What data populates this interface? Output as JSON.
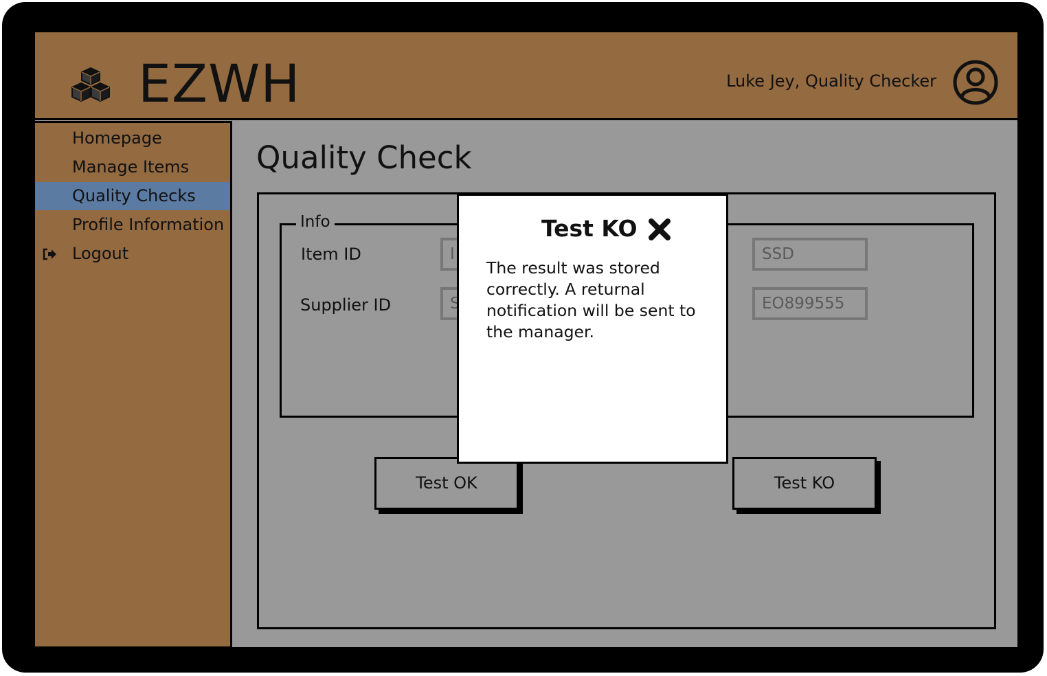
{
  "header": {
    "app_title": "EZWH",
    "user_label": "Luke Jey, Quality Checker"
  },
  "sidebar": {
    "items": [
      {
        "label": "Homepage"
      },
      {
        "label": "Manage Items"
      },
      {
        "label": "Quality Checks",
        "active": true
      },
      {
        "label": "Profile Information"
      },
      {
        "label": "Logout"
      }
    ]
  },
  "main": {
    "page_title": "Quality Check",
    "info": {
      "legend": "Info",
      "item_id_label": "Item ID",
      "supplier_id_label": "Supplier ID",
      "item_id_left_visible": "I",
      "supplier_id_left_visible": "S",
      "item_id_value": "SSD",
      "supplier_id_value": "EO899555"
    },
    "buttons": {
      "test_ok": "Test OK",
      "test_ko": "Test KO"
    }
  },
  "modal": {
    "title": "Test KO",
    "message": "The result was stored correctly. A returnal notification will be sent to the manager."
  },
  "colors": {
    "header_bg": "#946a41",
    "sidebar_bg": "#946a41",
    "active_item": "#5c7ba3",
    "content_bg": "#999999"
  },
  "icons": {
    "logo": "cubes-icon",
    "avatar": "user-avatar-icon",
    "logout": "logout-icon",
    "close": "close-icon"
  }
}
